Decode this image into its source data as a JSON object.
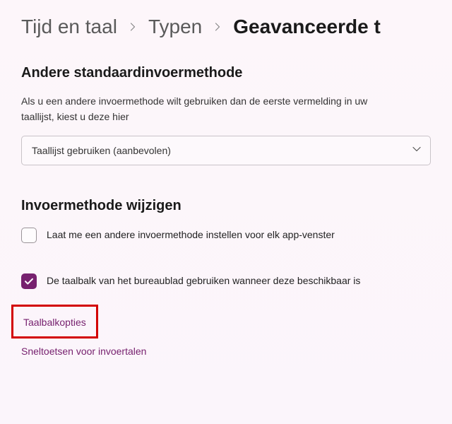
{
  "breadcrumb": {
    "crumbs": [
      {
        "label": "Tijd en taal"
      },
      {
        "label": "Typen"
      }
    ],
    "current": "Geavanceerde t"
  },
  "section_input": {
    "heading": "Andere standaardinvoermethode",
    "description": "Als u een andere invoermethode wilt gebruiken dan de eerste vermelding in uw taallijst, kiest u deze hier",
    "select_value": "Taallijst gebruiken (aanbevolen)"
  },
  "section_change": {
    "heading": "Invoermethode wijzigen",
    "chk_per_window": {
      "label": "Laat me een andere invoermethode instellen voor elk app-venster",
      "checked": false
    },
    "chk_desktop_bar": {
      "label": "De taalbalk van het bureaublad gebruiken wanneer deze beschikbaar is",
      "checked": true
    },
    "link_langbar": "Taalbalkopties",
    "link_hotkeys": "Sneltoetsen voor invoertalen"
  }
}
